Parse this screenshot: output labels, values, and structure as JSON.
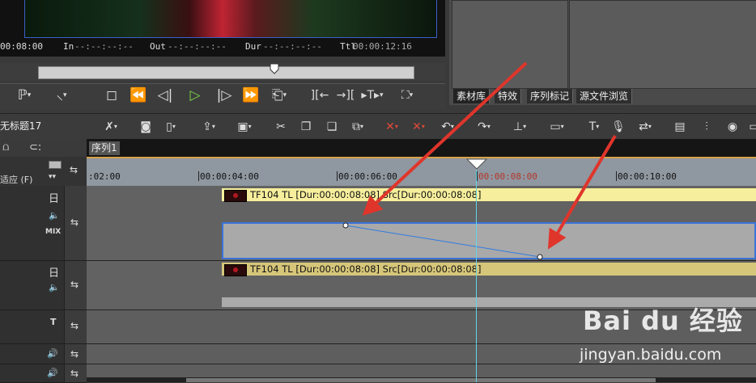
{
  "preview": {
    "timecode_left": "00:08:00",
    "in_label": "In",
    "in_value": "--:--:--:--",
    "out_label": "Out",
    "out_value": "--:--:--:--",
    "dur_label": "Dur",
    "dur_value": "--:--:--:--",
    "ttl_label": "Ttl",
    "ttl_value": "00:00:12:16",
    "scrub_position": 0.63
  },
  "transport": {
    "buttons": [
      "set-in",
      "set-out",
      "stop",
      "rewind",
      "step-back",
      "play",
      "step-forward",
      "fast-forward",
      "loop",
      "insert",
      "overwrite",
      "add-to-timeline",
      "match-frame"
    ]
  },
  "panel_tabs": [
    "素材库",
    "特效",
    "序列标记",
    "源文件浏览"
  ],
  "timeline": {
    "sequence_title": "无标题17",
    "sequence_tab": "序列1",
    "zoom_label": "适应 (F)",
    "ruler_labels": [
      ":02:00",
      "00:00:04:00",
      "00:00:06:00",
      "00:00:08:00",
      "00:00:10:00"
    ],
    "tracks": [
      {
        "id": "v1",
        "kind": "video",
        "mix_label": "MIX",
        "clip_text": "TF104  TL [Dur:00:00:08:08]  Src[Dur:00:00:08:08]"
      },
      {
        "id": "a1",
        "kind": "audio",
        "clip_text": "TF104  TL [Dur:00:00:08:08]  Src[Dur:00:00:08:08]"
      },
      {
        "id": "t1",
        "kind": "title",
        "label": "T"
      },
      {
        "id": "a2",
        "kind": "audio"
      },
      {
        "id": "a3",
        "kind": "audio"
      }
    ]
  },
  "watermark": {
    "brand": "Bai du 经验",
    "url": "jingyan.baidu.com"
  },
  "colors": {
    "accent_arrow": "#e0352b",
    "playhead": "#62d5e5",
    "clip_video": "#f6ee9c",
    "clip_audio": "#d6c67a",
    "selection": "#3b73d8"
  }
}
